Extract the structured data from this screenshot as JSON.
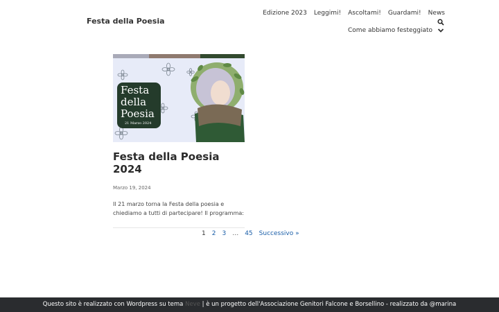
{
  "site": {
    "title": "Festa della Poesia"
  },
  "nav": {
    "items": [
      "Edizione 2023",
      "Leggimi!",
      "Ascoltami!",
      "Guardami!",
      "News"
    ],
    "dropdown": "Come abbiamo festeggiato"
  },
  "post": {
    "image_text": {
      "line1": "Festa",
      "line2": "della",
      "line3": "Poesia",
      "date": "21 Marzo 2024"
    },
    "title": "Festa della Poesia 2024",
    "date": "Marzo 19, 2024",
    "excerpt": "Il 21 marzo torna la Festa della poesia e chiediamo a tutti di partecipare! Il programma:"
  },
  "pagination": {
    "current": "1",
    "pages": [
      "2",
      "3"
    ],
    "ellipsis": "…",
    "last": "45",
    "next": "Successivo »"
  },
  "footer": {
    "part1": "Questo sito è realizzato con Wordpress su tema",
    "theme": "Neve",
    "part2": " | è un progetto dell'Associazione Genitori Falcone e Borsellino - realizzato da @marina"
  },
  "colors": {
    "accent_link": "#1a5ea8",
    "footer_bg": "#2a2c2f",
    "badge_green": "#243b2b"
  }
}
